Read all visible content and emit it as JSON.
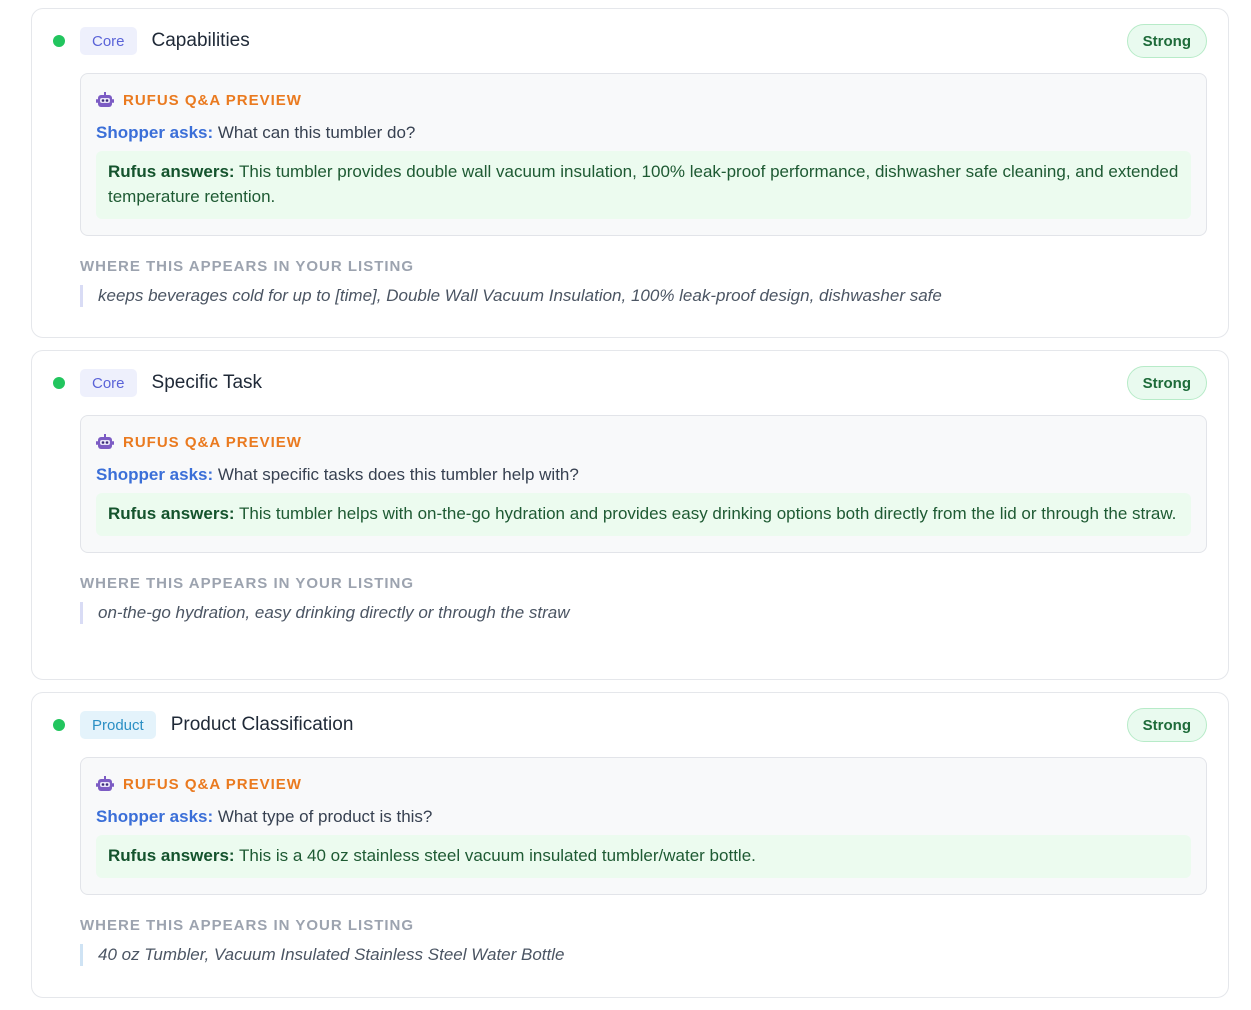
{
  "preview_label": "RUFUS Q&A PREVIEW",
  "shopper_prefix": "Shopper asks:",
  "rufus_prefix": "Rufus answers:",
  "where_label": "WHERE THIS APPEARS IN YOUR LISTING",
  "colors": {
    "status_dot": "#22c55e",
    "core_tag": "#5a63d8",
    "product_tag": "#2b8fc4",
    "strong_badge": "#1e6b3a",
    "preview_accent": "#ea7a1f"
  },
  "icons": {
    "status": "status-dot-icon",
    "preview": "robot-icon"
  },
  "cards": [
    {
      "tag": "Core",
      "tag_type": "core",
      "title": "Capabilities",
      "strength": "Strong",
      "question": "What can this tumbler do?",
      "answer": "This tumbler provides double wall vacuum insulation, 100% leak-proof performance, dishwasher safe cleaning, and extended temperature retention.",
      "listing_text": "keeps beverages cold for up to [time], Double Wall Vacuum Insulation, 100% leak-proof design, dishwasher safe"
    },
    {
      "tag": "Core",
      "tag_type": "core",
      "title": "Specific Task",
      "strength": "Strong",
      "question": "What specific tasks does this tumbler help with?",
      "answer": "This tumbler helps with on-the-go hydration and provides easy drinking options both directly from the lid or through the straw.",
      "listing_text": "on-the-go hydration, easy drinking directly or through the straw"
    },
    {
      "tag": "Product",
      "tag_type": "product",
      "title": "Product Classification",
      "strength": "Strong",
      "question": "What type of product is this?",
      "answer": "This is a 40 oz stainless steel vacuum insulated tumbler/water bottle.",
      "listing_text": "40 oz Tumbler, Vacuum Insulated Stainless Steel Water Bottle"
    }
  ]
}
